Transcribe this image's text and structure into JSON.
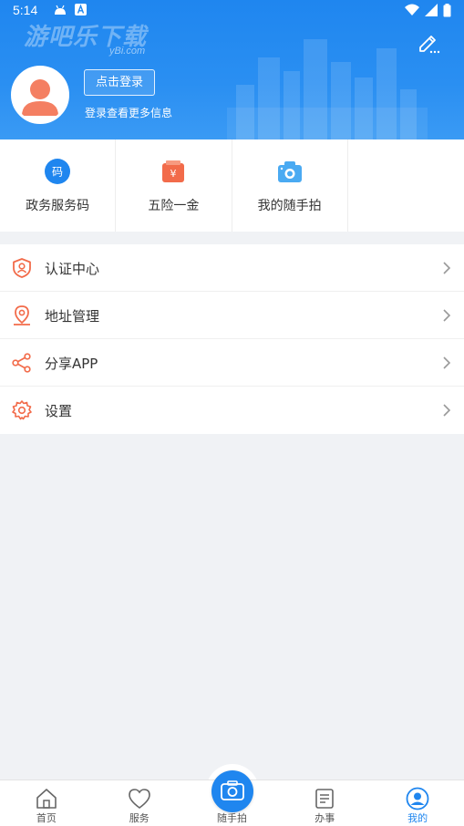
{
  "status_bar": {
    "time": "5:14"
  },
  "header": {
    "watermark": "游吧乐下载",
    "watermark_sub": "yBi.com",
    "login_button": "点击登录",
    "login_hint": "登录查看更多信息"
  },
  "quick_tiles": [
    {
      "label": "政务服务码",
      "icon": "gov-code-icon",
      "color": "#1f86ef"
    },
    {
      "label": "五险一金",
      "icon": "wallet-yen-icon",
      "color": "#f26b4a"
    },
    {
      "label": "我的随手拍",
      "icon": "camera-icon",
      "color": "#4aaaf2"
    }
  ],
  "menu": [
    {
      "label": "认证中心",
      "icon": "shield-user-icon"
    },
    {
      "label": "地址管理",
      "icon": "location-icon"
    },
    {
      "label": "分享APP",
      "icon": "share-icon"
    },
    {
      "label": "设置",
      "icon": "gear-icon"
    }
  ],
  "bottom_nav": [
    {
      "label": "首页",
      "icon": "home-icon"
    },
    {
      "label": "服务",
      "icon": "heart-icon"
    },
    {
      "label": "随手拍",
      "icon": "camera-icon"
    },
    {
      "label": "办事",
      "icon": "document-icon"
    },
    {
      "label": "我的",
      "icon": "user-icon",
      "active": true
    }
  ],
  "colors": {
    "primary": "#1f86ef",
    "accent_orange": "#f26b4a",
    "background": "#f0f2f5"
  }
}
